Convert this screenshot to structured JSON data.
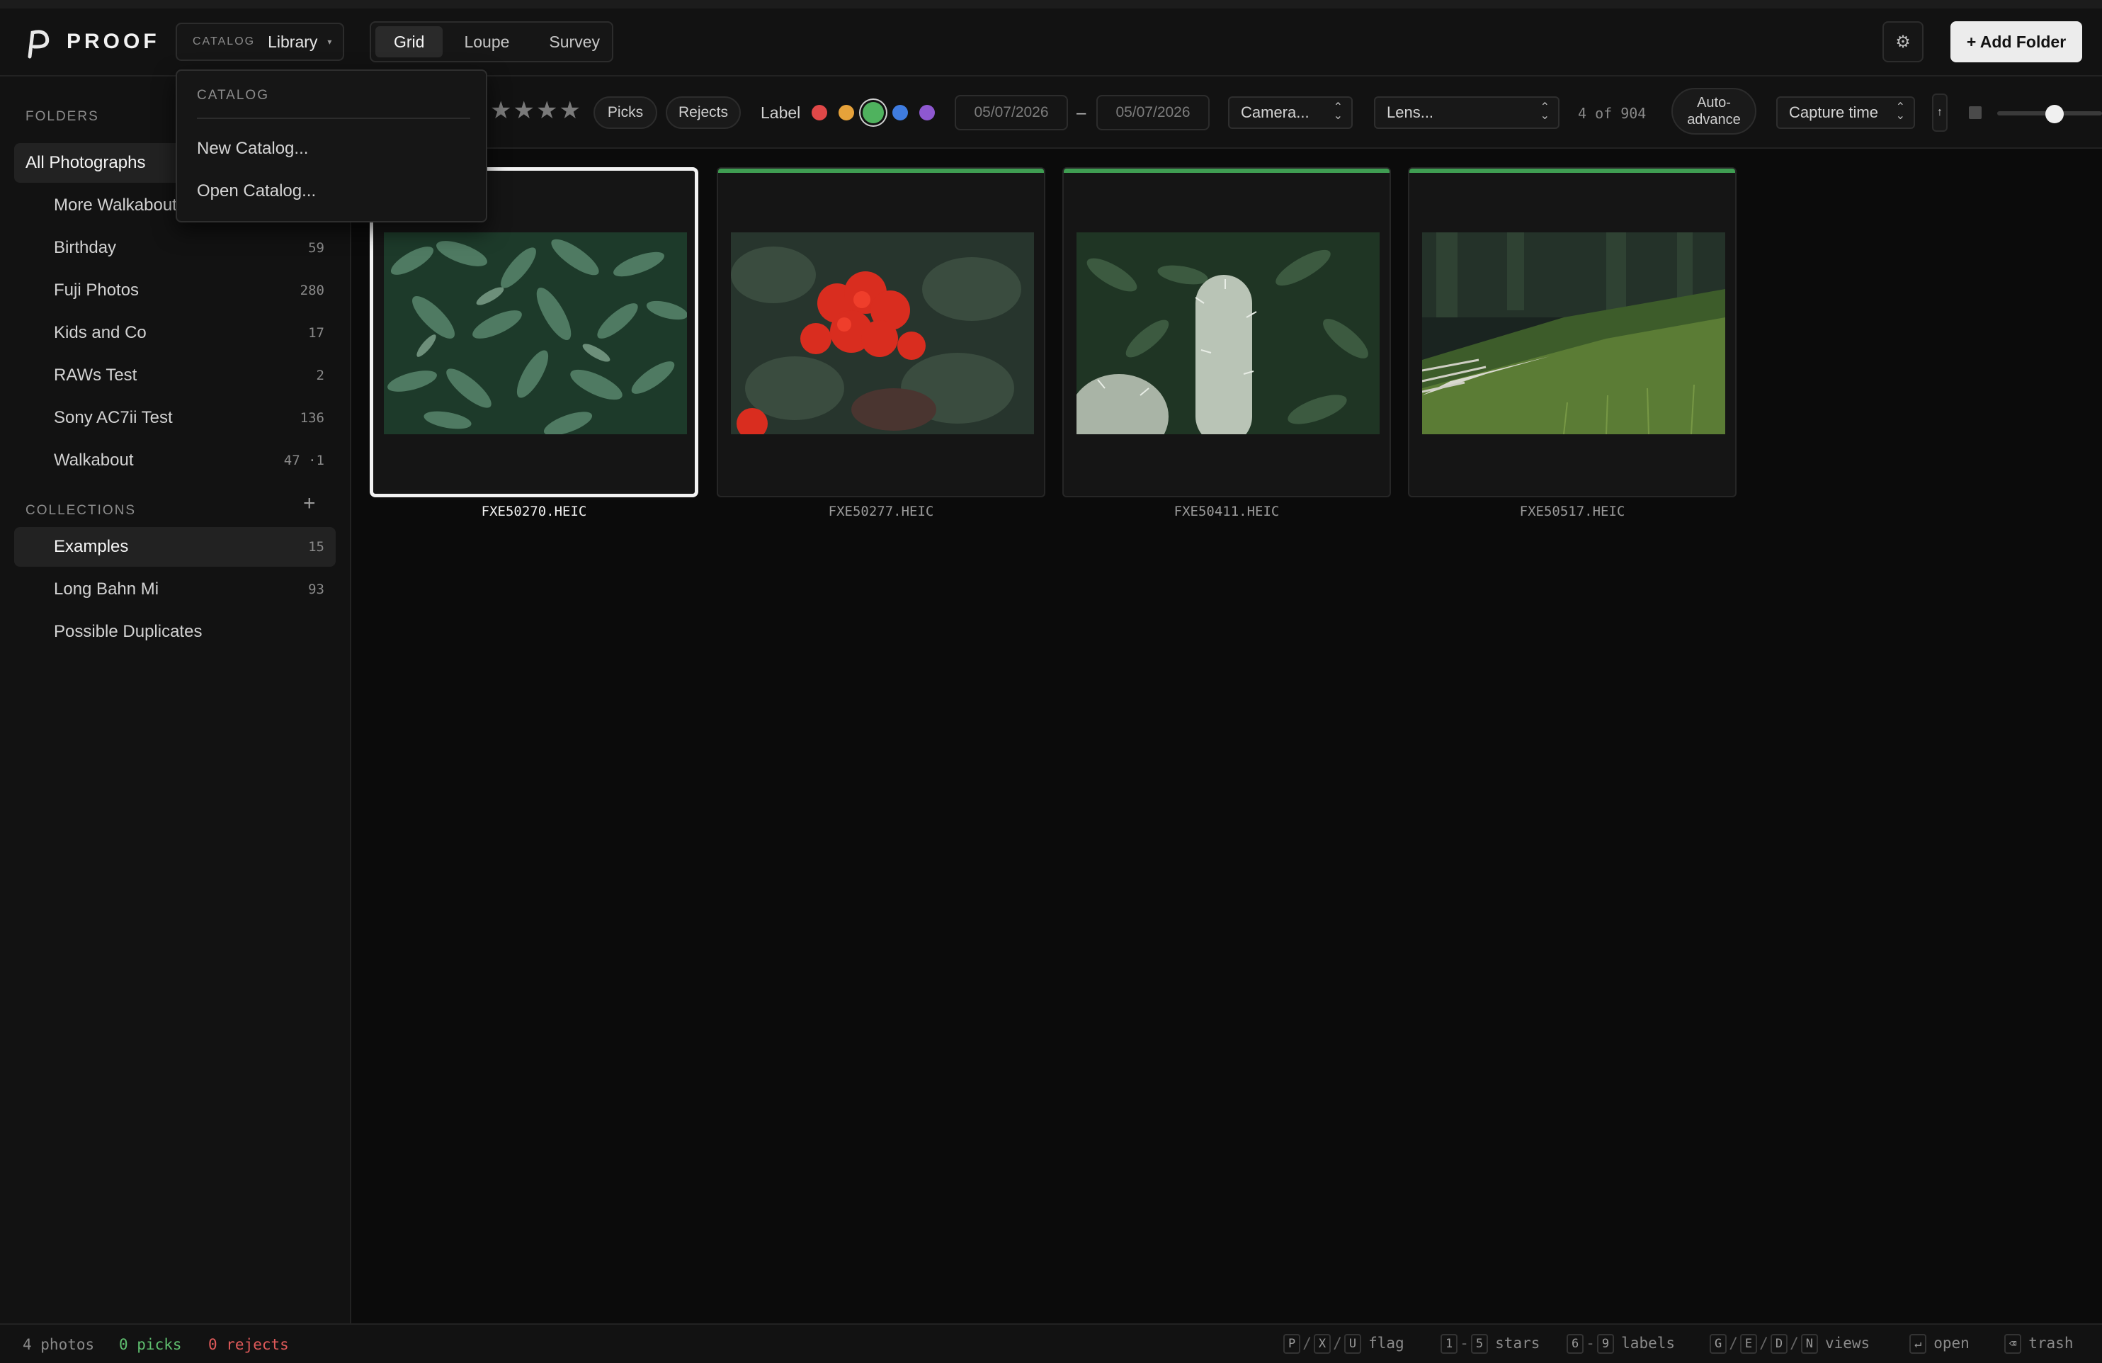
{
  "app": {
    "name": "PROOF"
  },
  "catalog": {
    "small_label": "CATALOG",
    "value": "Library"
  },
  "view_tabs": [
    "Grid",
    "Loupe",
    "Survey"
  ],
  "active_view": "Grid",
  "header": {
    "add_folder_label": "+ Add Folder",
    "settings_icon": "gear-icon"
  },
  "sidebar": {
    "folders_heading": "FOLDERS",
    "all_photographs": "All Photographs",
    "folders": [
      {
        "label": "More Walkabout",
        "count": ""
      },
      {
        "label": "Birthday",
        "count": "59"
      },
      {
        "label": "Fuji Photos",
        "count": "280"
      },
      {
        "label": "Kids and Co",
        "count": "17"
      },
      {
        "label": "RAWs Test",
        "count": "2"
      },
      {
        "label": "Sony AC7ii Test",
        "count": "136"
      },
      {
        "label": "Walkabout",
        "count": "47 ·1"
      }
    ],
    "collections_heading": "COLLECTIONS",
    "add_collection": "+",
    "collections": [
      {
        "label": "Examples",
        "count": "15",
        "active": true
      },
      {
        "label": "Long Bahn Mi",
        "count": "93"
      },
      {
        "label": "Possible Duplicates",
        "count": ""
      }
    ]
  },
  "filters": {
    "stars": "★★★★",
    "picks_label": "Picks",
    "rejects_label": "Rejects",
    "label_text": "Label",
    "label_colors": [
      "#e04848",
      "#e6a23a",
      "#4fb25e",
      "#3f7ce0",
      "#8e58d0"
    ],
    "selected_label_color": "#4fb25e",
    "date_from": "05/07/2026",
    "date_to": "05/07/2026",
    "date_sep": "–",
    "camera": "Camera...",
    "lens": "Lens...",
    "count": "4 of 904",
    "auto_advance_line1": "Auto-",
    "auto_advance_line2": "advance",
    "sort": "Capture time",
    "sort_dir": "↑",
    "grid_size_fraction": 0.5
  },
  "catalog_menu": {
    "heading": "CATALOG",
    "items": [
      "New Catalog...",
      "Open Catalog..."
    ]
  },
  "photos": [
    {
      "filename": "FXE50270.HEIC",
      "selected": true,
      "flag": "pick",
      "subject": "leaves"
    },
    {
      "filename": "FXE50277.HEIC",
      "selected": false,
      "flag": "pick",
      "subject": "red-flower"
    },
    {
      "filename": "FXE50411.HEIC",
      "selected": false,
      "flag": "pick",
      "subject": "cactus"
    },
    {
      "filename": "FXE50517.HEIC",
      "selected": false,
      "flag": "pick",
      "subject": "park"
    }
  ],
  "status": {
    "photos": "4 photos",
    "picks": "0 picks",
    "rejects": "0 rejects",
    "picks_color": "#5fbf6f",
    "rejects_color": "#e05a5a",
    "shortcuts": [
      {
        "keys": [
          "P",
          "X",
          "U"
        ],
        "sep": "/",
        "label": "flag"
      },
      {
        "keys": [
          "1",
          "5"
        ],
        "sep": "-",
        "label": "stars"
      },
      {
        "keys": [
          "6",
          "9"
        ],
        "sep": "-",
        "label": "labels"
      },
      {
        "keys": [
          "G",
          "E",
          "D",
          "N"
        ],
        "sep": "/",
        "label": "views"
      },
      {
        "keys": [
          "↵"
        ],
        "sep": "",
        "label": "open"
      },
      {
        "keys": [
          "⌫"
        ],
        "sep": "",
        "label": "trash"
      }
    ]
  }
}
